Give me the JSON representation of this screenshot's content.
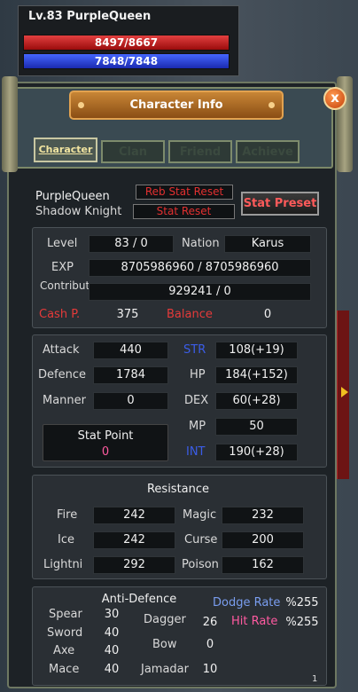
{
  "player": {
    "level_name": "Lv.83 PurpleQueen",
    "hp": "8497/8667",
    "mp": "7848/7848"
  },
  "window": {
    "title": "Character Info",
    "close_label": "x"
  },
  "tabs": [
    {
      "label": "Character",
      "active": true
    },
    {
      "label": "Clan",
      "active": false
    },
    {
      "label": "Friend",
      "active": false
    },
    {
      "label": "Achieve",
      "active": false
    }
  ],
  "identity": {
    "name": "PurpleQueen",
    "class": "Shadow Knight",
    "reb_stat_reset": "Reb Stat Reset",
    "stat_reset": "Stat Reset",
    "stat_preset": "Stat Preset"
  },
  "info": {
    "level_label": "Level",
    "level_value": "83 / 0",
    "nation_label": "Nation",
    "nation_value": "Karus",
    "exp_label": "EXP",
    "exp_value": "8705986960 / 8705986960",
    "contrib_label": "Contribut",
    "contrib_value": "929241 / 0",
    "cash_label": "Cash P.",
    "cash_value": "375",
    "balance_label": "Balance",
    "balance_value": "0"
  },
  "combat": {
    "attack_label": "Attack",
    "attack_value": "440",
    "defence_label": "Defence",
    "defence_value": "1784",
    "manner_label": "Manner",
    "manner_value": "0",
    "str_label": "STR",
    "str_value": "108(+19)",
    "hp_label": "HP",
    "hp_value": "184(+152)",
    "dex_label": "DEX",
    "dex_value": "60(+28)",
    "mp_label": "MP",
    "mp_value": "50",
    "int_label": "INT",
    "int_value": "190(+28)",
    "stat_point_label": "Stat Point",
    "stat_point_value": "0"
  },
  "resistance": {
    "heading": "Resistance",
    "fire_label": "Fire",
    "fire_value": "242",
    "ice_label": "Ice",
    "ice_value": "242",
    "lightning_label": "Lightni",
    "lightning_value": "292",
    "magic_label": "Magic",
    "magic_value": "232",
    "curse_label": "Curse",
    "curse_value": "200",
    "poison_label": "Poison",
    "poison_value": "162"
  },
  "anti_defence": {
    "heading": "Anti-Defence",
    "spear_label": "Spear",
    "spear_value": "30",
    "sword_label": "Sword",
    "sword_value": "40",
    "axe_label": "Axe",
    "axe_value": "40",
    "mace_label": "Mace",
    "mace_value": "40",
    "dagger_label": "Dagger",
    "dagger_value": "26",
    "bow_label": "Bow",
    "bow_value": "0",
    "jamadar_label": "Jamadar",
    "jamadar_value": "10",
    "dodge_label": "Dodge Rate",
    "dodge_value": "%255",
    "hit_label": "Hit Rate",
    "hit_value": "%255"
  },
  "footer_num": "1",
  "colors": {
    "hp": "#c21a1a",
    "mp": "#2a3fd8",
    "accent": "#c88636"
  }
}
